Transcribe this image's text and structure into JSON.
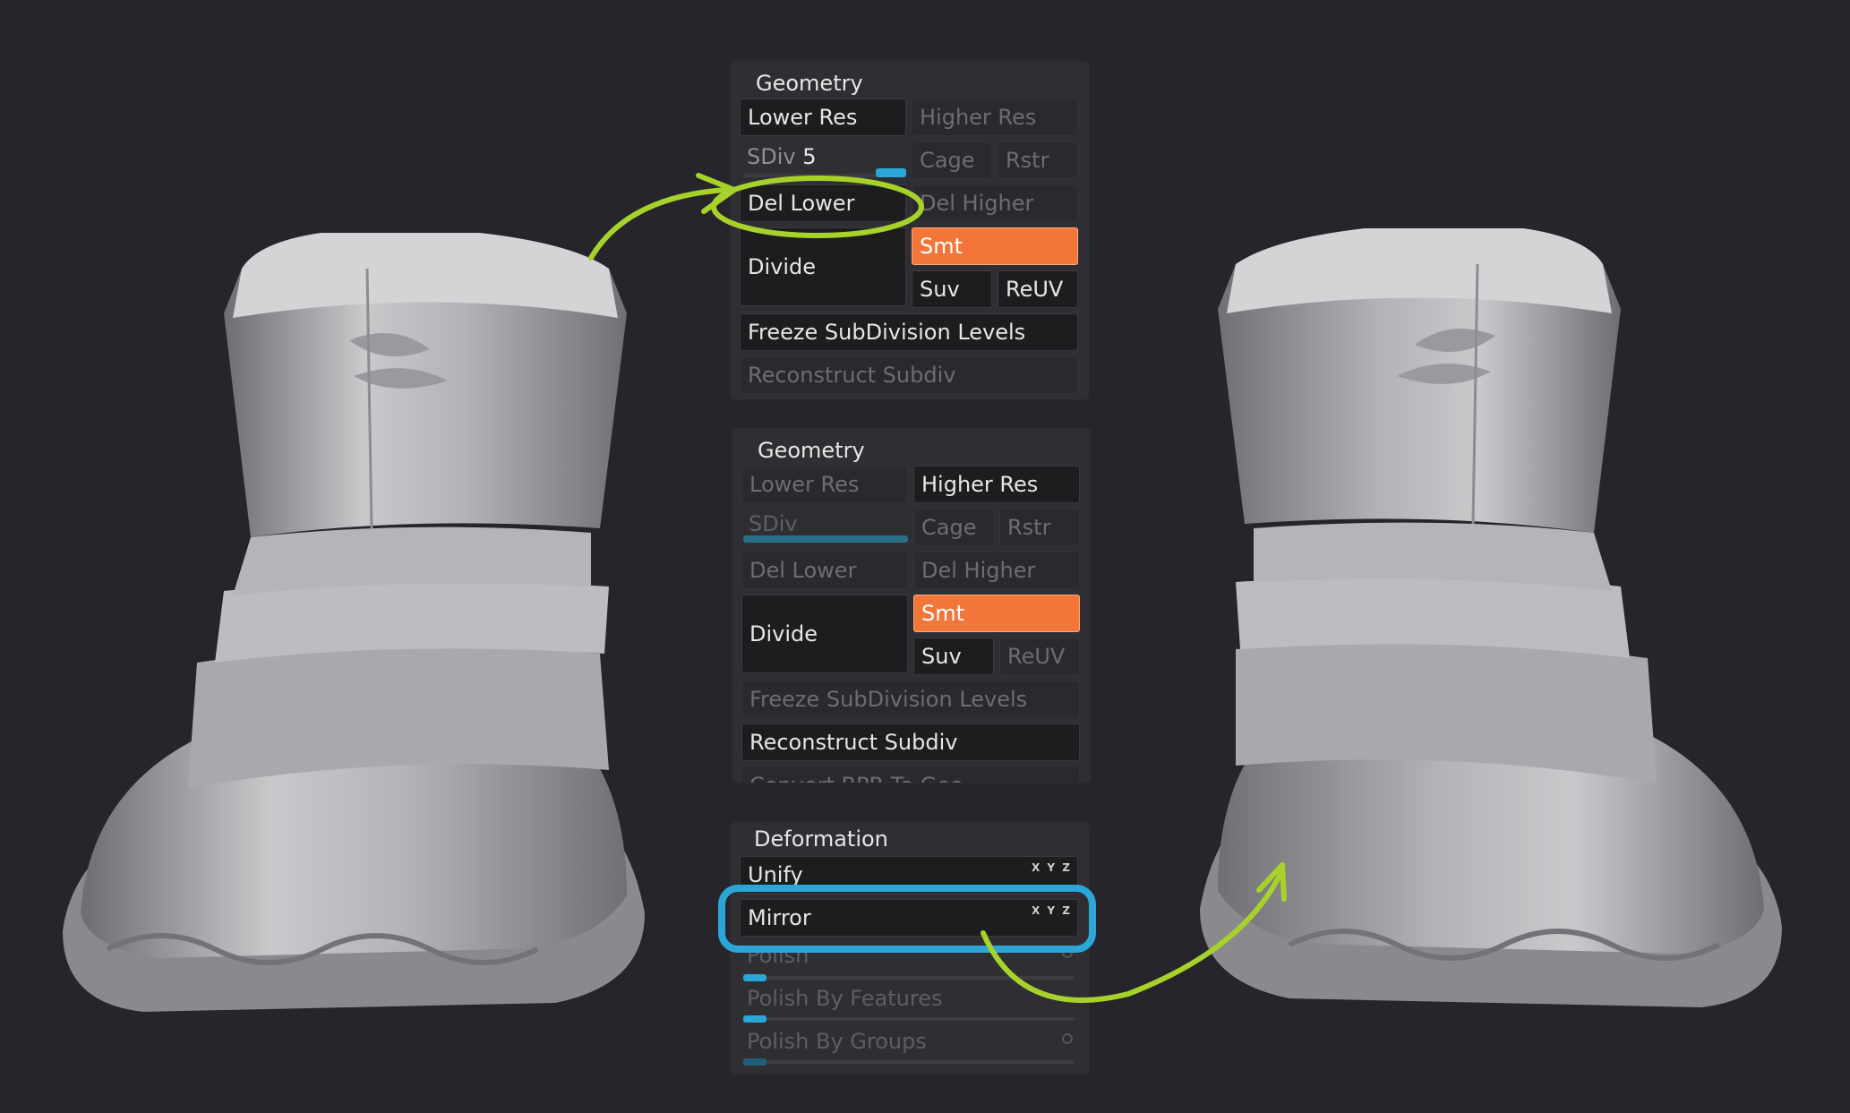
{
  "colors": {
    "background": "#25252b",
    "panel": "#2f2f33",
    "button": "#1d1d20",
    "active_orange": "#f2763a",
    "highlight_green": "#a6d22a",
    "highlight_blue": "#2aa7d8"
  },
  "geometry_top": {
    "title": "Geometry",
    "lower_res": "Lower Res",
    "higher_res": "Higher Res",
    "sdiv_label": "SDiv",
    "sdiv_value": "5",
    "cage": "Cage",
    "rstr": "Rstr",
    "del_lower": "Del Lower",
    "del_higher": "Del Higher",
    "divide": "Divide",
    "smt": "Smt",
    "suv": "Suv",
    "reuv": "ReUV",
    "freeze": "Freeze SubDivision Levels",
    "reconstruct": "Reconstruct Subdiv"
  },
  "geometry_bottom": {
    "title": "Geometry",
    "lower_res": "Lower Res",
    "higher_res": "Higher Res",
    "sdiv_label": "SDiv",
    "cage": "Cage",
    "rstr": "Rstr",
    "del_lower": "Del Lower",
    "del_higher": "Del Higher",
    "divide": "Divide",
    "smt": "Smt",
    "suv": "Suv",
    "reuv": "ReUV",
    "freeze": "Freeze SubDivision Levels",
    "reconstruct": "Reconstruct Subdiv",
    "convert": "Convert BPR To Geo"
  },
  "deformation": {
    "title": "Deformation",
    "unify": "Unify",
    "mirror": "Mirror",
    "polish": "Polish",
    "polish_features": "Polish By Features",
    "polish_groups": "Polish By Groups",
    "axis_labels": "X Y Z"
  },
  "icons": {
    "left_model": "boot-3d-model",
    "right_model": "boot-3d-model-mirrored",
    "arrow_1": "green-arrow",
    "arrow_2": "green-arrow"
  }
}
